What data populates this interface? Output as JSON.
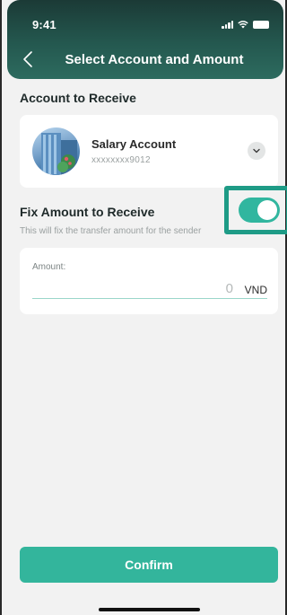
{
  "status_bar": {
    "time": "9:41"
  },
  "nav": {
    "title": "Select Account and Amount"
  },
  "account_section": {
    "label": "Account to Receive",
    "account": {
      "name": "Salary Account",
      "number": "xxxxxxxx9012"
    }
  },
  "fix_amount": {
    "label": "Fix Amount to Receive",
    "helper": "This will fix the transfer amount for the sender",
    "enabled": true
  },
  "amount": {
    "label": "Amount:",
    "value": "0",
    "currency": "VND"
  },
  "confirm": {
    "label": "Confirm"
  },
  "colors": {
    "accent": "#33b59c",
    "header": "#1b3a36",
    "highlight": "#1e9b86"
  }
}
